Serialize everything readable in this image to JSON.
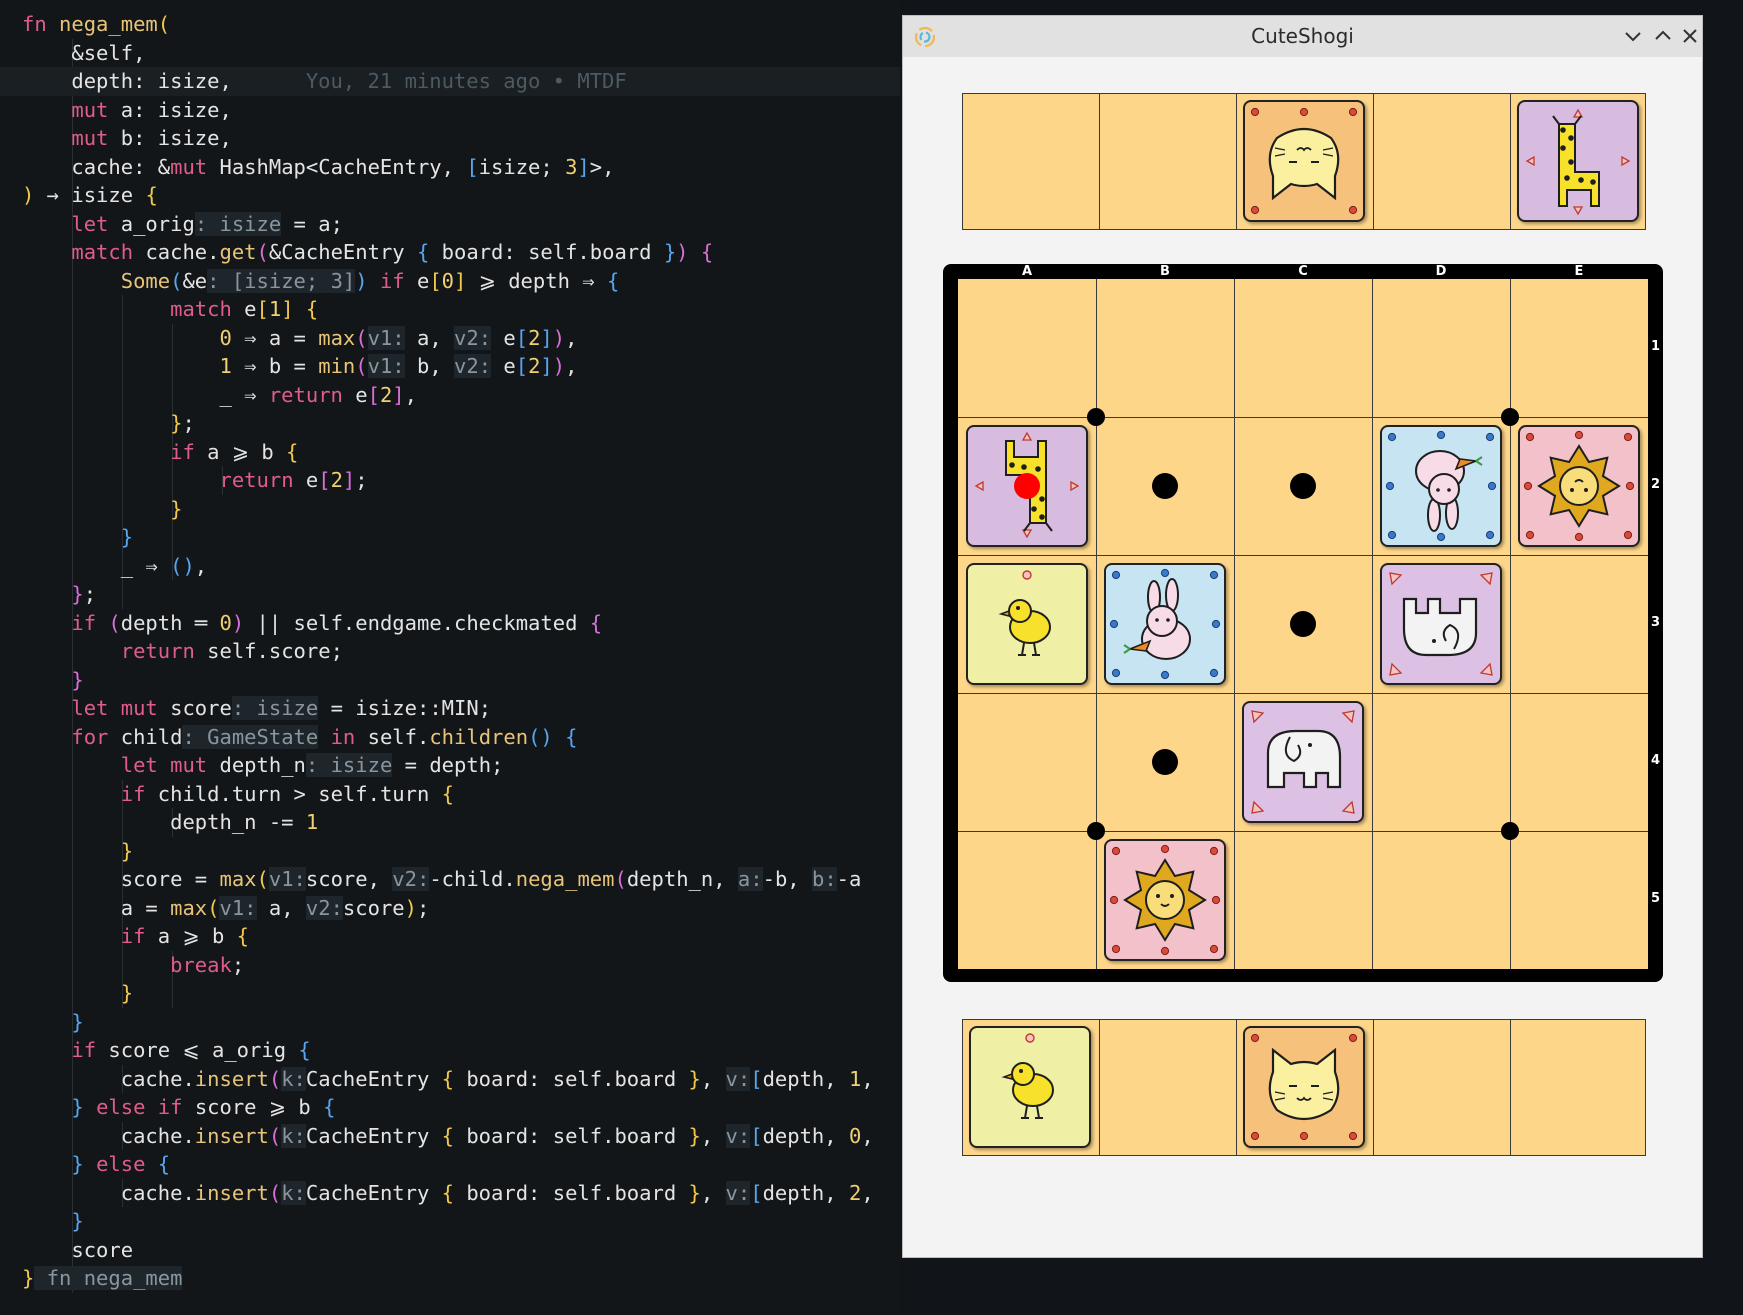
{
  "editor": {
    "blame": "You, 21 minutes ago • MTDF",
    "lines": [
      [
        [
          "kw",
          "fn "
        ],
        [
          "fnn",
          "nega_mem"
        ],
        [
          "br1",
          "("
        ]
      ],
      [
        [
          "",
          "    &self,"
        ]
      ],
      [
        [
          "",
          "    depth: isize,"
        ]
      ],
      [
        [
          "",
          "    "
        ],
        [
          "kw",
          "mut "
        ],
        [
          "",
          "a: isize,"
        ]
      ],
      [
        [
          "",
          "    "
        ],
        [
          "kw",
          "mut "
        ],
        [
          "",
          "b: isize,"
        ]
      ],
      [
        [
          "",
          "    cache: &"
        ],
        [
          "kw",
          "mut "
        ],
        [
          "",
          "HashMap<CacheEntry, "
        ],
        [
          "br3",
          "["
        ],
        [
          "",
          "isize; "
        ],
        [
          "num",
          "3"
        ],
        [
          "br3",
          "]"
        ],
        [
          "",
          ">,"
        ]
      ],
      [
        [
          "br1",
          ")"
        ],
        [
          "",
          " → isize "
        ],
        [
          "br1",
          "{"
        ]
      ],
      [
        [
          "",
          "    "
        ],
        [
          "kw",
          "let "
        ],
        [
          "",
          "a_orig"
        ],
        [
          "hint",
          ": isize"
        ],
        [
          "",
          " = a;"
        ]
      ],
      [
        [
          "",
          "    "
        ],
        [
          "kw",
          "match "
        ],
        [
          "",
          "cache."
        ],
        [
          "fnn",
          "get"
        ],
        [
          "br2",
          "("
        ],
        [
          "",
          "&CacheEntry "
        ],
        [
          "br3",
          "{"
        ],
        [
          "",
          " board: self.board "
        ],
        [
          "br3",
          "}"
        ],
        [
          "br2",
          ")"
        ],
        [
          "",
          " "
        ],
        [
          "br2",
          "{"
        ]
      ],
      [
        [
          "",
          "        "
        ],
        [
          "fnn",
          "Some"
        ],
        [
          "br3",
          "("
        ],
        [
          "",
          "&e"
        ],
        [
          "hint",
          ": [isize; 3]"
        ],
        [
          "br3",
          ")"
        ],
        [
          "",
          " "
        ],
        [
          "kw",
          "if "
        ],
        [
          "",
          "e"
        ],
        [
          "br1",
          "["
        ],
        [
          "num",
          "0"
        ],
        [
          "br1",
          "]"
        ],
        [
          "",
          " ⩾ depth ⇒ "
        ],
        [
          "br3",
          "{"
        ]
      ],
      [
        [
          "",
          "            "
        ],
        [
          "kw",
          "match "
        ],
        [
          "",
          "e"
        ],
        [
          "br1",
          "["
        ],
        [
          "num",
          "1"
        ],
        [
          "br1",
          "]"
        ],
        [
          "",
          " "
        ],
        [
          "br1",
          "{"
        ]
      ],
      [
        [
          "",
          "                "
        ],
        [
          "num",
          "0"
        ],
        [
          "",
          " ⇒ a = "
        ],
        [
          "fnn",
          "max"
        ],
        [
          "br2",
          "("
        ],
        [
          "hint",
          "v1:"
        ],
        [
          "",
          " a, "
        ],
        [
          "hint",
          "v2:"
        ],
        [
          "",
          " e"
        ],
        [
          "br3",
          "["
        ],
        [
          "num",
          "2"
        ],
        [
          "br3",
          "]"
        ],
        [
          "br2",
          ")"
        ],
        [
          "",
          ","
        ]
      ],
      [
        [
          "",
          "                "
        ],
        [
          "num",
          "1"
        ],
        [
          "",
          " ⇒ b = "
        ],
        [
          "fnn",
          "min"
        ],
        [
          "br2",
          "("
        ],
        [
          "hint",
          "v1:"
        ],
        [
          "",
          " b, "
        ],
        [
          "hint",
          "v2:"
        ],
        [
          "",
          " e"
        ],
        [
          "br3",
          "["
        ],
        [
          "num",
          "2"
        ],
        [
          "br3",
          "]"
        ],
        [
          "br2",
          ")"
        ],
        [
          "",
          ","
        ]
      ],
      [
        [
          "",
          "                _ ⇒ "
        ],
        [
          "kw",
          "return "
        ],
        [
          "",
          "e"
        ],
        [
          "br2",
          "["
        ],
        [
          "num",
          "2"
        ],
        [
          "br2",
          "]"
        ],
        [
          "",
          ","
        ]
      ],
      [
        [
          "",
          "            "
        ],
        [
          "br1",
          "}"
        ],
        [
          "",
          ";"
        ]
      ],
      [
        [
          "",
          "            "
        ],
        [
          "kw",
          "if "
        ],
        [
          "",
          "a ⩾ b "
        ],
        [
          "br1",
          "{"
        ]
      ],
      [
        [
          "",
          "                "
        ],
        [
          "kw",
          "return "
        ],
        [
          "",
          "e"
        ],
        [
          "br2",
          "["
        ],
        [
          "num",
          "2"
        ],
        [
          "br2",
          "]"
        ],
        [
          "",
          ";"
        ]
      ],
      [
        [
          "",
          "            "
        ],
        [
          "br1",
          "}"
        ]
      ],
      [
        [
          "",
          "        "
        ],
        [
          "br3",
          "}"
        ]
      ],
      [
        [
          "",
          "        _ ⇒ "
        ],
        [
          "br3",
          "()"
        ],
        [
          "",
          ","
        ]
      ],
      [
        [
          "",
          "    "
        ],
        [
          "br2",
          "}"
        ],
        [
          "",
          ";"
        ]
      ],
      [
        [
          "",
          "    "
        ],
        [
          "kw",
          "if "
        ],
        [
          "br2",
          "("
        ],
        [
          "",
          "depth "
        ],
        [
          "",
          "═ "
        ],
        [
          "num",
          "0"
        ],
        [
          "br2",
          ")"
        ],
        [
          "",
          " || self.endgame.checkmated "
        ],
        [
          "br2",
          "{"
        ]
      ],
      [
        [
          "",
          "        "
        ],
        [
          "kw",
          "return "
        ],
        [
          "",
          "self.score;"
        ]
      ],
      [
        [
          "",
          "    "
        ],
        [
          "br2",
          "}"
        ]
      ],
      [
        [
          "",
          "    "
        ],
        [
          "kw",
          "let mut "
        ],
        [
          "",
          "score"
        ],
        [
          "hint",
          ": isize"
        ],
        [
          "",
          " = isize::MIN;"
        ]
      ],
      [
        [
          "",
          "    "
        ],
        [
          "kw",
          "for "
        ],
        [
          "",
          "child"
        ],
        [
          "hint",
          ": GameState"
        ],
        [
          "",
          " "
        ],
        [
          "kw",
          "in "
        ],
        [
          "",
          "self."
        ],
        [
          "fnn",
          "children"
        ],
        [
          "br3",
          "()"
        ],
        [
          "",
          " "
        ],
        [
          "br3",
          "{"
        ]
      ],
      [
        [
          "",
          "        "
        ],
        [
          "kw",
          "let mut "
        ],
        [
          "",
          "depth_n"
        ],
        [
          "hint",
          ": isize"
        ],
        [
          "",
          " = depth;"
        ]
      ],
      [
        [
          "",
          "        "
        ],
        [
          "kw",
          "if "
        ],
        [
          "",
          "child.turn > self.turn "
        ],
        [
          "br1",
          "{"
        ]
      ],
      [
        [
          "",
          "            depth_n -= "
        ],
        [
          "num",
          "1"
        ]
      ],
      [
        [
          "",
          "        "
        ],
        [
          "br1",
          "}"
        ]
      ],
      [
        [
          "",
          "        score = "
        ],
        [
          "fnn",
          "max"
        ],
        [
          "br1",
          "("
        ],
        [
          "hint",
          "v1:"
        ],
        [
          "",
          "score, "
        ],
        [
          "hint",
          "v2:"
        ],
        [
          "",
          "-child."
        ],
        [
          "fnn",
          "nega_mem"
        ],
        [
          "br2",
          "("
        ],
        [
          "",
          "depth_n, "
        ],
        [
          "hint",
          "a:"
        ],
        [
          "",
          "-b, "
        ],
        [
          "hint",
          "b:"
        ],
        [
          "",
          "-a"
        ]
      ],
      [
        [
          "",
          "        a = "
        ],
        [
          "fnn",
          "max"
        ],
        [
          "br1",
          "("
        ],
        [
          "hint",
          "v1:"
        ],
        [
          "",
          " a, "
        ],
        [
          "hint",
          "v2:"
        ],
        [
          "",
          "score"
        ],
        [
          "br1",
          ")"
        ],
        [
          "",
          ";"
        ]
      ],
      [
        [
          "",
          "        "
        ],
        [
          "kw",
          "if "
        ],
        [
          "",
          "a ⩾ b "
        ],
        [
          "br1",
          "{"
        ]
      ],
      [
        [
          "",
          "            "
        ],
        [
          "kw",
          "break"
        ],
        [
          "",
          ";"
        ]
      ],
      [
        [
          "",
          "        "
        ],
        [
          "br1",
          "}"
        ]
      ],
      [
        [
          "",
          "    "
        ],
        [
          "br3",
          "}"
        ]
      ],
      [
        [
          "",
          "    "
        ],
        [
          "kw",
          "if "
        ],
        [
          "",
          "score ⩽ a_orig "
        ],
        [
          "br3",
          "{"
        ]
      ],
      [
        [
          "",
          "        cache."
        ],
        [
          "fnn",
          "insert"
        ],
        [
          "br2",
          "("
        ],
        [
          "hint",
          "k:"
        ],
        [
          "",
          "CacheEntry "
        ],
        [
          "br1",
          "{"
        ],
        [
          "",
          " board: self.board "
        ],
        [
          "br1",
          "}"
        ],
        [
          "",
          ", "
        ],
        [
          "hint",
          "v:"
        ],
        [
          "br3",
          "["
        ],
        [
          "",
          "depth, "
        ],
        [
          "num",
          "1"
        ],
        [
          "",
          ","
        ]
      ],
      [
        [
          "",
          "    "
        ],
        [
          "br3",
          "}"
        ],
        [
          "",
          " "
        ],
        [
          "kw",
          "else if "
        ],
        [
          "",
          "score ⩾ b "
        ],
        [
          "br3",
          "{"
        ]
      ],
      [
        [
          "",
          "        cache."
        ],
        [
          "fnn",
          "insert"
        ],
        [
          "br2",
          "("
        ],
        [
          "hint",
          "k:"
        ],
        [
          "",
          "CacheEntry "
        ],
        [
          "br1",
          "{"
        ],
        [
          "",
          " board: self.board "
        ],
        [
          "br1",
          "}"
        ],
        [
          "",
          ", "
        ],
        [
          "hint",
          "v:"
        ],
        [
          "br3",
          "["
        ],
        [
          "",
          "depth, "
        ],
        [
          "num",
          "0"
        ],
        [
          "",
          ","
        ]
      ],
      [
        [
          "",
          "    "
        ],
        [
          "br3",
          "}"
        ],
        [
          "",
          " "
        ],
        [
          "kw",
          "else "
        ],
        [
          "br3",
          "{"
        ]
      ],
      [
        [
          "",
          "        cache."
        ],
        [
          "fnn",
          "insert"
        ],
        [
          "br2",
          "("
        ],
        [
          "hint",
          "k:"
        ],
        [
          "",
          "CacheEntry "
        ],
        [
          "br1",
          "{"
        ],
        [
          "",
          " board: self.board "
        ],
        [
          "br1",
          "}"
        ],
        [
          "",
          ", "
        ],
        [
          "hint",
          "v:"
        ],
        [
          "br3",
          "["
        ],
        [
          "",
          "depth, "
        ],
        [
          "num",
          "2"
        ],
        [
          "",
          ","
        ]
      ],
      [
        [
          "",
          "    "
        ],
        [
          "br3",
          "}"
        ]
      ],
      [
        [
          "",
          "    score"
        ]
      ],
      [
        [
          "br1",
          "}"
        ],
        [
          "hint",
          " fn nega_mem"
        ]
      ]
    ]
  },
  "window": {
    "title": "CuteShogi",
    "icons": {
      "app": "app-icon",
      "minimize": "chevron-down-icon",
      "maximize": "chevron-up-icon",
      "close": "close-icon"
    }
  },
  "game": {
    "columns": [
      "A",
      "B",
      "C",
      "D",
      "E"
    ],
    "rows": [
      "1",
      "2",
      "3",
      "4",
      "5"
    ],
    "pieces": [
      {
        "kind": "giraffe",
        "col": 0,
        "row": 1
      },
      {
        "kind": "rabbit",
        "col": 3,
        "row": 1,
        "flipped": true
      },
      {
        "kind": "lion",
        "col": 4,
        "row": 1,
        "flipped": true
      },
      {
        "kind": "chick",
        "col": 0,
        "row": 2
      },
      {
        "kind": "rabbit",
        "col": 1,
        "row": 2
      },
      {
        "kind": "elephant",
        "col": 3,
        "row": 2,
        "flipped": true
      },
      {
        "kind": "elephant",
        "col": 2,
        "row": 3
      },
      {
        "kind": "lion",
        "col": 1,
        "row": 4
      }
    ],
    "move_hints": [
      {
        "col": 1,
        "row": 1
      },
      {
        "col": 2,
        "row": 1
      },
      {
        "col": 2,
        "row": 2
      },
      {
        "col": 1,
        "row": 3
      }
    ],
    "selected_square": {
      "col": 0,
      "row": 1
    },
    "hand_top": [
      {
        "slot": 2,
        "kind": "cat",
        "flipped": true
      },
      {
        "slot": 4,
        "kind": "giraffe",
        "flipped": true
      }
    ],
    "hand_bottom": [
      {
        "slot": 0,
        "kind": "chick"
      },
      {
        "slot": 2,
        "kind": "cat"
      }
    ],
    "colors": {
      "square": "#fed68a",
      "board_frame": "#000000",
      "chick": "#efefa5",
      "giraffe": "#d8bce0",
      "rabbit": "#c7e4f2",
      "lion": "#f2c1c9",
      "elephant": "#dcc1e4",
      "cat": "#f6c27b",
      "selection": "#ff0000"
    }
  }
}
